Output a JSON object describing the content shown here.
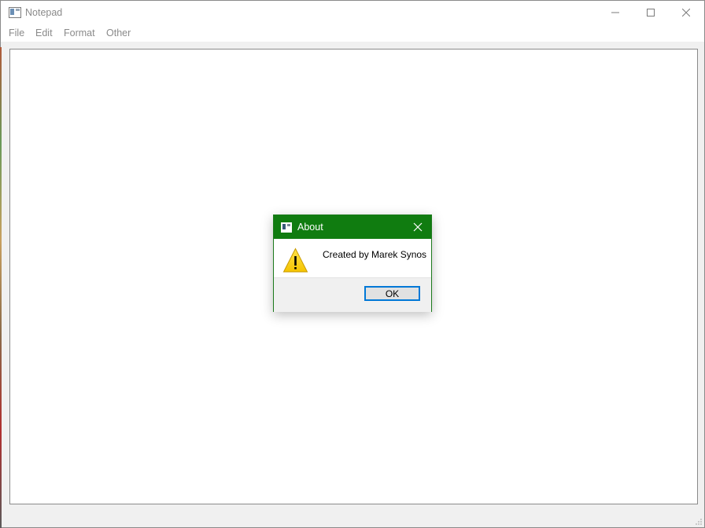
{
  "window": {
    "title": "Notepad",
    "icon": "notepad-app-icon",
    "controls": [
      "minimize-icon",
      "maximize-icon",
      "close-icon"
    ]
  },
  "menubar": {
    "items": [
      {
        "label": "File"
      },
      {
        "label": "Edit"
      },
      {
        "label": "Format"
      },
      {
        "label": "Other"
      }
    ]
  },
  "editor": {
    "text": ""
  },
  "dialog": {
    "title": "About",
    "icon": "warning-icon",
    "message": "Created by Marek Synos",
    "ok_label": "OK",
    "accent_color": "#107c10"
  }
}
